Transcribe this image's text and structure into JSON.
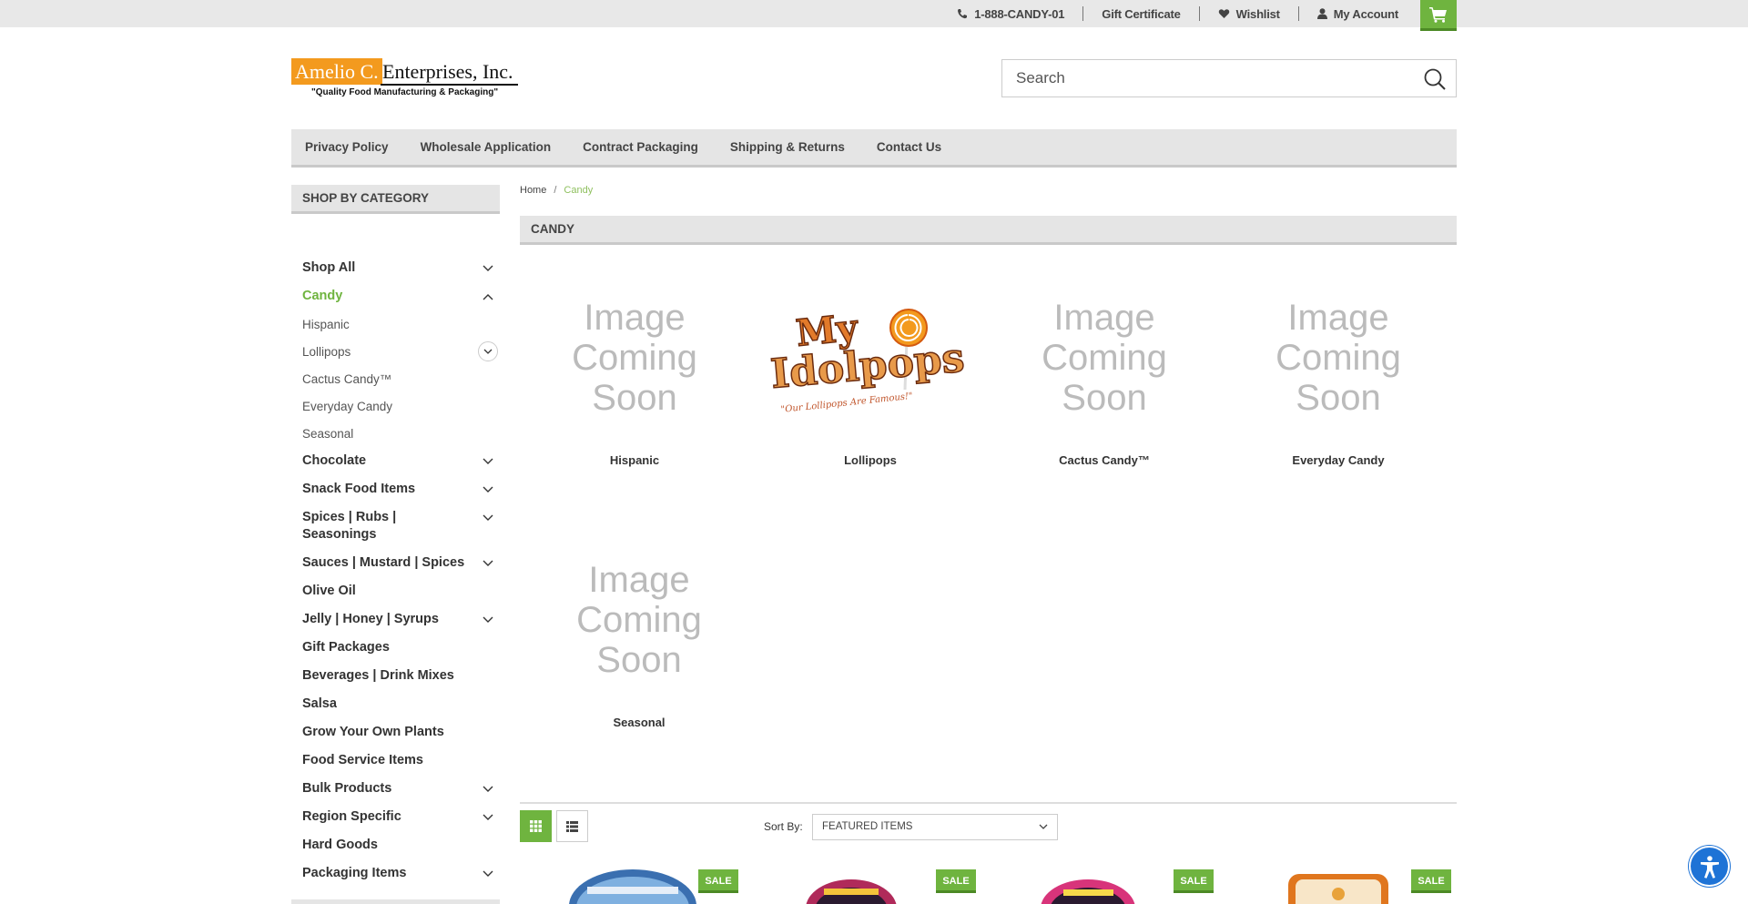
{
  "topbar": {
    "phone": "1-888-CANDY-01",
    "gift_certificate": "Gift Certificate",
    "wishlist": "Wishlist",
    "my_account": "My Account"
  },
  "logo": {
    "boxed": "Amelio C.",
    "rest": "Enterprises, Inc.",
    "tagline": "\"Quality Food Manufacturing & Packaging\""
  },
  "search": {
    "placeholder": "Search"
  },
  "nav": [
    "Privacy Policy",
    "Wholesale Application",
    "Contract Packaging",
    "Shipping & Returns",
    "Contact Us"
  ],
  "sidebar": {
    "heading": "SHOP BY CATEGORY",
    "items": [
      {
        "label": "Shop All"
      },
      {
        "label": "Candy"
      },
      {
        "label": "Hispanic"
      },
      {
        "label": "Lollipops"
      },
      {
        "label": "Cactus Candy™"
      },
      {
        "label": "Everyday Candy"
      },
      {
        "label": "Seasonal"
      },
      {
        "label": "Chocolate"
      },
      {
        "label": "Snack Food Items"
      },
      {
        "label": "Spices | Rubs | Seasonings"
      },
      {
        "label": "Sauces | Mustard | Spices"
      },
      {
        "label": "Olive Oil"
      },
      {
        "label": "Jelly | Honey | Syrups"
      },
      {
        "label": "Gift Packages"
      },
      {
        "label": "Beverages | Drink Mixes"
      },
      {
        "label": "Salsa"
      },
      {
        "label": "Grow Your Own Plants"
      },
      {
        "label": "Food Service Items"
      },
      {
        "label": "Bulk Products"
      },
      {
        "label": "Region Specific"
      },
      {
        "label": "Hard Goods"
      },
      {
        "label": "Packaging Items"
      }
    ]
  },
  "breadcrumb": {
    "home": "Home",
    "sep": "/",
    "current": "Candy"
  },
  "page_title": "CANDY",
  "image_placeholder": {
    "line1": "Image",
    "line2": "Coming",
    "line3": "Soon"
  },
  "lollipops_logo": {
    "line1": "My",
    "line2": "Idolpops",
    "tagline": "\"Our Lollipops Are Famous!\""
  },
  "subcategories": [
    "Hispanic",
    "Lollipops",
    "Cactus Candy™",
    "Everyday Candy",
    "Seasonal"
  ],
  "sort": {
    "label": "Sort By:",
    "value": "FEATURED ITEMS"
  },
  "badges": {
    "sale": "SALE"
  },
  "colors": {
    "accent": "#6fb43f",
    "orange": "#f39a1e",
    "a11y_blue": "#1e73d6"
  }
}
